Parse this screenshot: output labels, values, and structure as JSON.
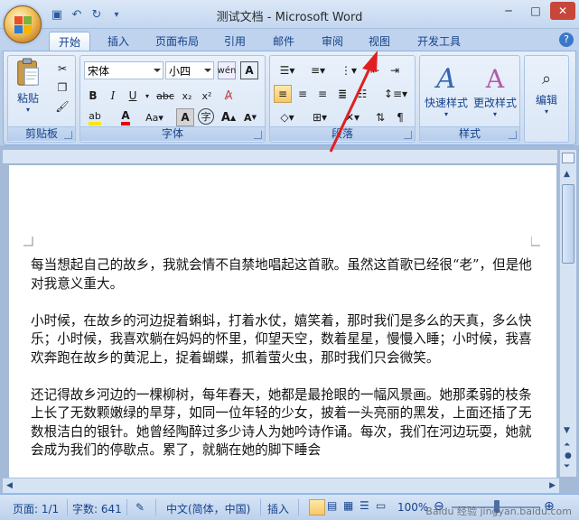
{
  "window": {
    "title": "测试文档 - Microsoft Word"
  },
  "quick_access": [
    {
      "icon": "save-icon",
      "glyph": "💾"
    },
    {
      "icon": "undo-icon",
      "glyph": "↶"
    },
    {
      "icon": "redo-icon",
      "glyph": "↻"
    },
    {
      "icon": "customize-qat-icon",
      "glyph": "▾"
    }
  ],
  "tabs": [
    {
      "label": "开始",
      "active": true
    },
    {
      "label": "插入"
    },
    {
      "label": "页面布局"
    },
    {
      "label": "引用"
    },
    {
      "label": "邮件"
    },
    {
      "label": "审阅"
    },
    {
      "label": "视图"
    },
    {
      "label": "开发工具"
    }
  ],
  "ribbon": {
    "clipboard": {
      "label": "剪贴板",
      "paste_label": "粘贴"
    },
    "font": {
      "label": "字体",
      "font_name": "宋体",
      "font_size": "小四"
    },
    "paragraph": {
      "label": "段落"
    },
    "styles": {
      "label": "样式",
      "quick_styles_label": "快速样式",
      "change_styles_label": "更改样式"
    },
    "editing": {
      "label": "编辑"
    }
  },
  "document": {
    "paragraphs": [
      "每当想起自己的故乡，我就会情不自禁地唱起这首歌。虽然这首歌已经很“老”，但是他对我意义重大。",
      "小时候，在故乡的河边捉着蝌蚪，打着水仗，嬉笑着，那时我们是多么的天真，多么快乐；小时候，我喜欢躺在妈妈的怀里，仰望天空，数着星星，慢慢入睡；小时候，我喜欢奔跑在故乡的黄泥上，捉着蝴蝶，抓着萤火虫，那时我们只会微笑。",
      "还记得故乡河边的一棵柳树，每年春天，她都是最抢眼的一幅风景画。她那柔弱的枝条上长了无数颗嫩绿的旱芽，如同一位年轻的少女，披着一头亮丽的黑发，上面还插了无数根洁白的银针。她曾经陶醉过多少诗人为她吟诗作诵。每次，我们在河边玩耍，她就会成为我们的停歇点。累了，就躺在她的脚下睡会"
    ]
  },
  "status": {
    "page": "页面: 1/1",
    "words": "字数: 641",
    "language": "中文(简体，中国)",
    "insert": "插入",
    "zoom": "100%"
  },
  "watermark": "Baidu 经验 jingyan.baidu.com"
}
